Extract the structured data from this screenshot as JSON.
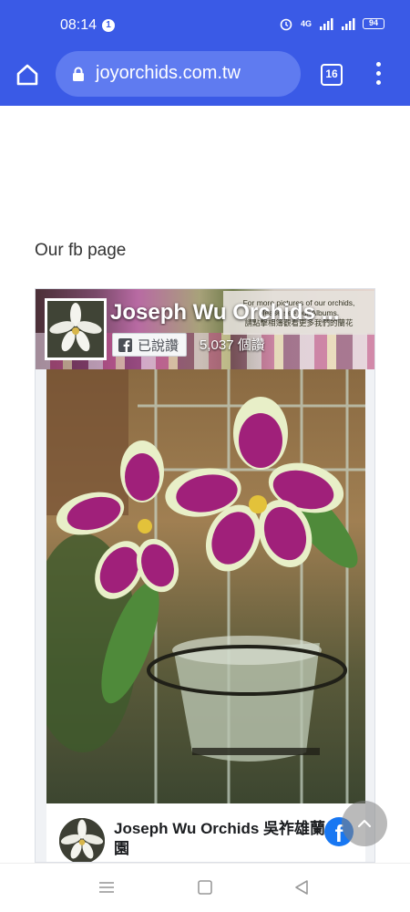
{
  "status_bar": {
    "time": "08:14",
    "notification_count": "1",
    "network": "4G",
    "battery": "94"
  },
  "browser": {
    "url": "joyorchids.com.tw",
    "tab_count": "16"
  },
  "page": {
    "section_title": "Our fb page"
  },
  "fb_widget": {
    "page_name": "Joseph Wu Orchids ...",
    "like_label": "已說讚",
    "like_count": "5,037 個讚",
    "cover_text_line1": "For more pictures of our orchids,",
    "cover_text_line2": "please see our Albums.",
    "cover_text_line3": "請點擊相簿觀看更多我們的蘭花",
    "post_author": "Joseph Wu Orchids 吳祚雄蘭園"
  },
  "colors": {
    "browser_bar": "#3a5ae6",
    "url_field": "#5f7bf0",
    "facebook_blue": "#1877f2"
  },
  "icons": {
    "home": "home-icon",
    "lock": "lock-icon",
    "menu": "more-vert-icon",
    "facebook": "facebook-icon",
    "scroll_top": "chevron-up-icon",
    "nav_recents": "menu-lines-icon",
    "nav_home": "square-icon",
    "nav_back": "triangle-back-icon"
  }
}
